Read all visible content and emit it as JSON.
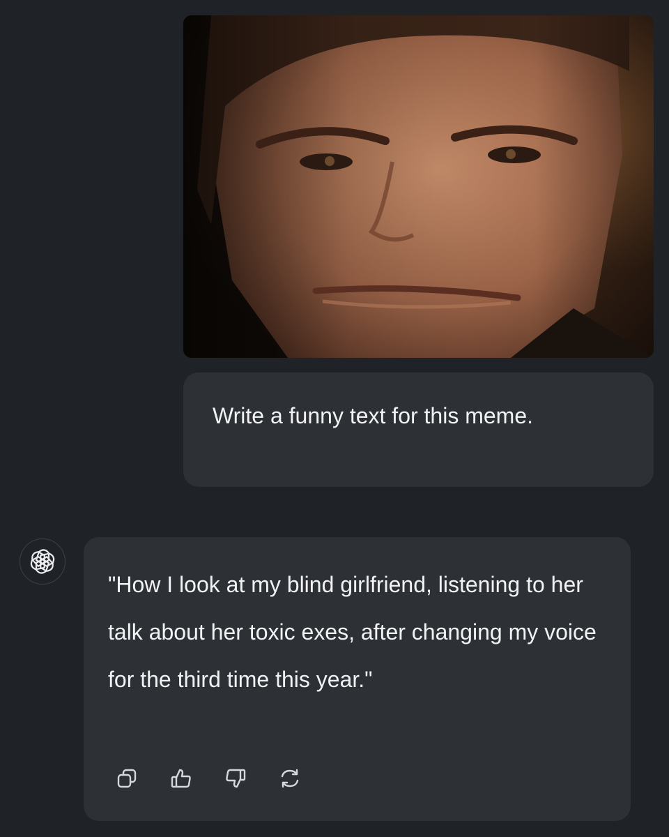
{
  "conversation": {
    "user_message": {
      "image_alt": "Close-up portrait of a man smirking under warm dim lighting",
      "text": "Write a funny text for this meme."
    },
    "assistant_message": {
      "avatar_icon": "openai-logo-icon",
      "text": "\"How I look at my blind girlfriend, listening to her talk about her toxic exes, after changing my voice for the third time this year.\"",
      "actions": [
        {
          "icon": "copy-icon"
        },
        {
          "icon": "thumbs-up-icon"
        },
        {
          "icon": "thumbs-down-icon"
        },
        {
          "icon": "regenerate-icon"
        }
      ]
    }
  },
  "colors": {
    "background": "#1f2226",
    "bubble": "#2d3035",
    "text": "#f1f2f4",
    "icon": "#d6d8db"
  }
}
